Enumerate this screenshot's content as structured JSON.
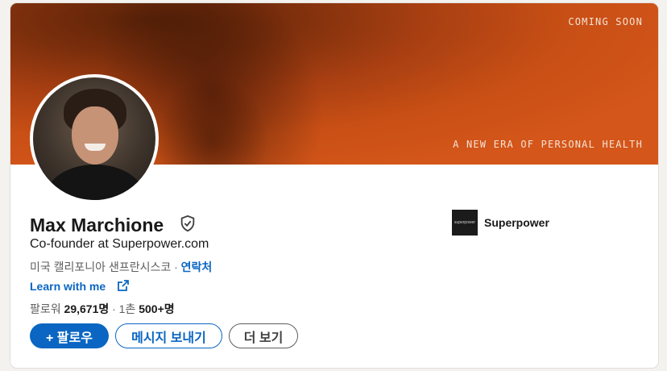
{
  "banner": {
    "top_text": "COMING SOON",
    "tagline": "A NEW ERA OF PERSONAL HEALTH"
  },
  "profile": {
    "name": "Max Marchione",
    "headline": "Co-founder at Superpower.com",
    "location": "미국 캘리포니아 샌프란시스코",
    "location_separator": " · ",
    "contact_label": "연락처",
    "learn_more_label": "Learn with me",
    "followers_label": "팔로워",
    "followers_count": "29,671명",
    "connections_prefix": " · 1촌 ",
    "connections_count": "500+명"
  },
  "company": {
    "logo_text": "superpower",
    "name": "Superpower"
  },
  "actions": {
    "follow_label": "+ 팔로우",
    "message_label": "메시지 보내기",
    "more_label": "더 보기"
  },
  "colors": {
    "accent": "#0a66c2",
    "banner": "#c84f15"
  }
}
